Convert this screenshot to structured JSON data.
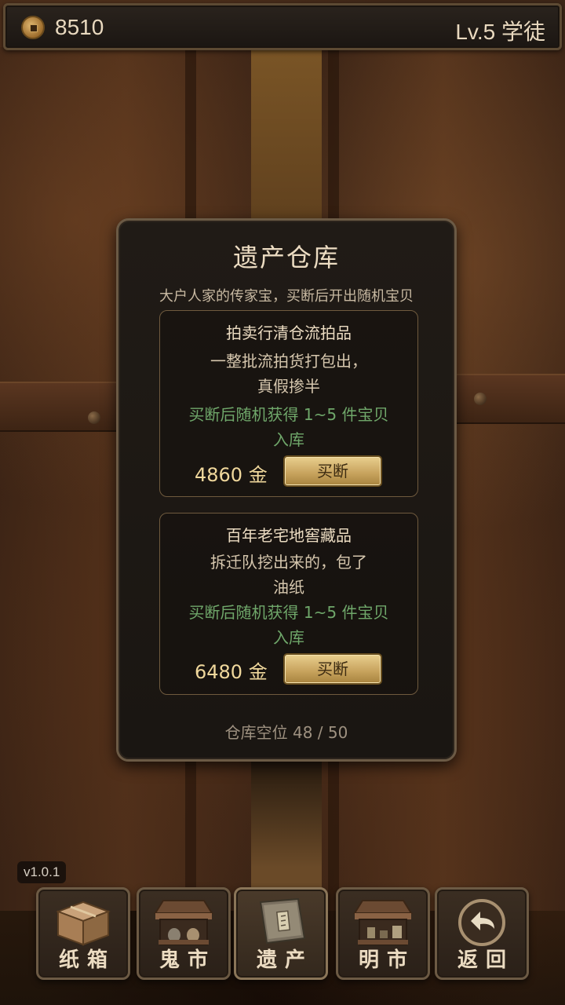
{
  "header": {
    "coins": "8510",
    "level": "Lv.5 学徒",
    "coin_icon": "coin-icon"
  },
  "dialog": {
    "title": "遗产仓库",
    "subtitle": "大户人家的传家宝，买断后开出随机宝贝",
    "items": [
      {
        "title": "拍卖行清仓流拍品",
        "desc_line1": "一整批流拍货打包出，",
        "desc_line2": "真假掺半",
        "reward_line1": "买断后随机获得 1~5 件宝贝",
        "reward_line2": "入库",
        "price": "4860 金",
        "button": "买断"
      },
      {
        "title": "百年老宅地窖藏品",
        "desc_line1": "拆迁队挖出来的，包了",
        "desc_line2": "油纸",
        "reward_line1": "买断后随机获得 1~5 件宝贝",
        "reward_line2": "入库",
        "price": "6480 金",
        "button": "买断"
      }
    ],
    "capacity": "仓库空位 48 / 50"
  },
  "version": "v1.0.1",
  "nav": [
    {
      "label": "纸箱",
      "icon": "box-icon"
    },
    {
      "label": "鬼市",
      "icon": "ghost-market-stall-icon"
    },
    {
      "label": "遗产",
      "icon": "heritage-book-icon",
      "active": true
    },
    {
      "label": "明市",
      "icon": "market-stall-icon"
    },
    {
      "label": "返回",
      "icon": "return-arrow-icon"
    }
  ],
  "colors": {
    "accent_gold": "#f0d89c",
    "reward_green": "#6fa76a",
    "button_gold": "#c9a560"
  }
}
